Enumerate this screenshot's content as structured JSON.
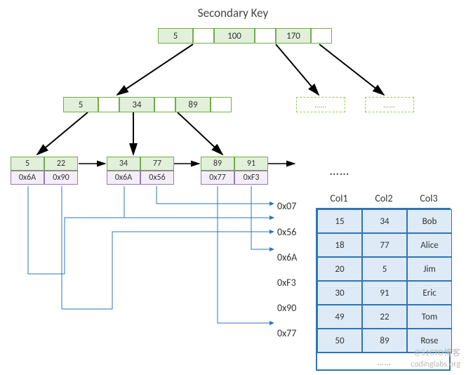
{
  "title": "Secondary Key",
  "root": {
    "keys": [
      "5",
      "100",
      "170"
    ]
  },
  "level1": {
    "keys": [
      "5",
      "34",
      "89"
    ]
  },
  "ghosts": [
    "……",
    "……"
  ],
  "leaves": [
    {
      "keys": [
        "5",
        "22"
      ],
      "ptrs": [
        "0x6A",
        "0x90"
      ]
    },
    {
      "keys": [
        "34",
        "77"
      ],
      "ptrs": [
        "0x6A",
        "0x56"
      ]
    },
    {
      "keys": [
        "89",
        "91"
      ],
      "ptrs": [
        "0x77",
        "0xF3"
      ]
    }
  ],
  "leaf_ellipsis": "……",
  "hex_labels": [
    "0x07",
    "0x56",
    "0x6A",
    "0xF3",
    "0x90",
    "0x77"
  ],
  "table": {
    "headers": [
      "Col1",
      "Col2",
      "Col3"
    ],
    "rows": [
      [
        "15",
        "34",
        "Bob"
      ],
      [
        "18",
        "77",
        "Alice"
      ],
      [
        "20",
        "5",
        "Jim"
      ],
      [
        "30",
        "91",
        "Eric"
      ],
      [
        "49",
        "22",
        "Tom"
      ],
      [
        "50",
        "89",
        "Rose"
      ]
    ],
    "footer": "……"
  },
  "watermark1": "@51CTO博客",
  "watermark2": "codinglabs.org"
}
